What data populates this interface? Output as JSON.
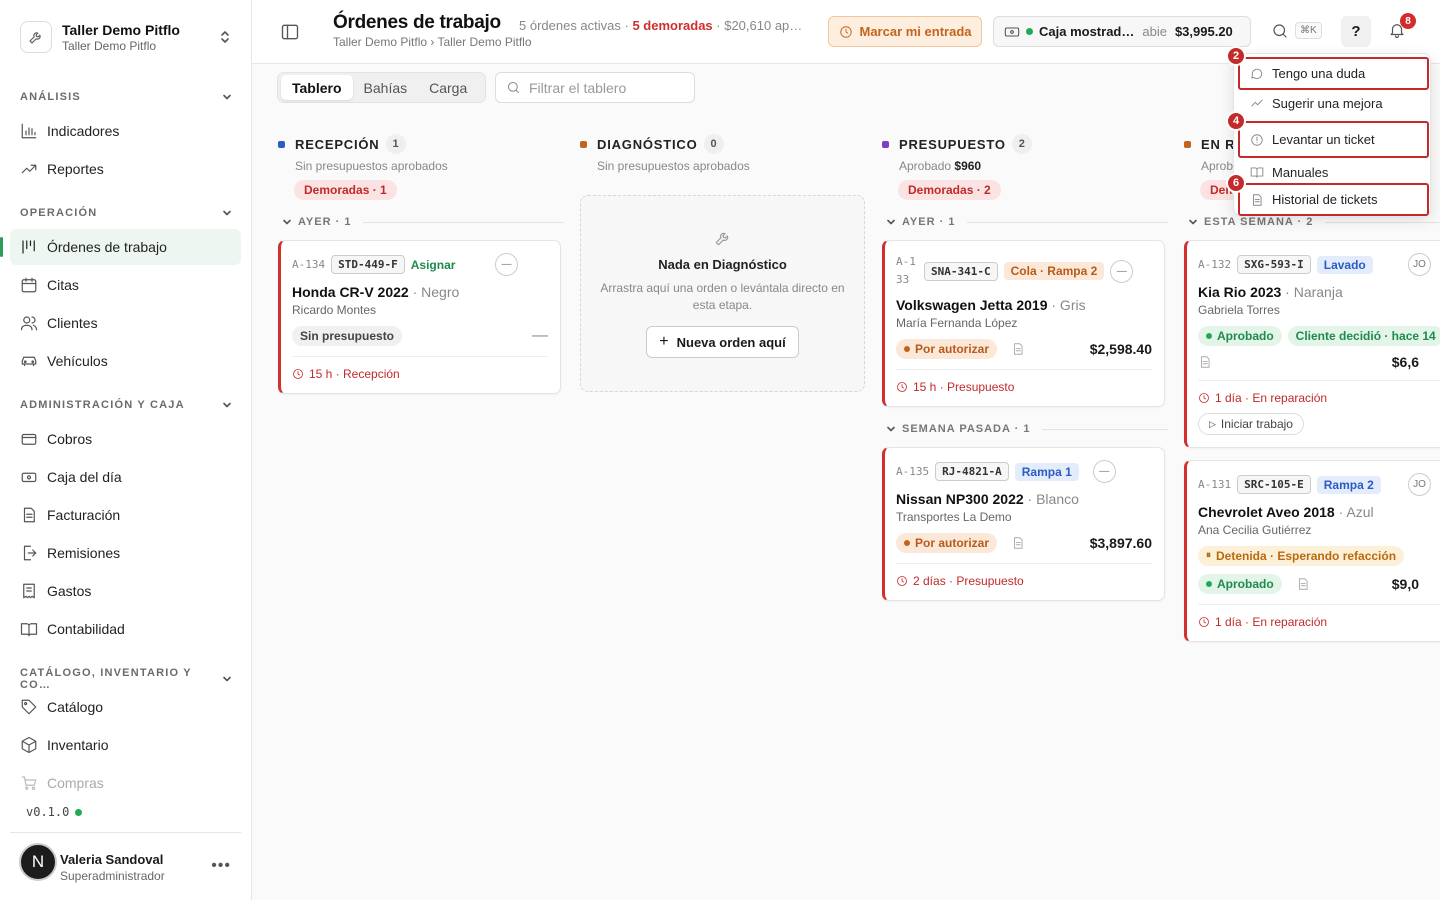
{
  "workspace": {
    "name": "Taller Demo Pitflo",
    "sub": "Taller Demo Pitflo"
  },
  "sidebar": {
    "sections": [
      {
        "label": "ANÁLISIS",
        "items": [
          {
            "label": "Indicadores",
            "icon": "bar-chart-icon"
          },
          {
            "label": "Reportes",
            "icon": "trend-icon"
          }
        ]
      },
      {
        "label": "OPERACIÓN",
        "items": [
          {
            "label": "Órdenes de trabajo",
            "icon": "kanban-icon",
            "active": true
          },
          {
            "label": "Citas",
            "icon": "calendar-icon"
          },
          {
            "label": "Clientes",
            "icon": "users-icon"
          },
          {
            "label": "Vehículos",
            "icon": "car-icon"
          }
        ]
      },
      {
        "label": "ADMINISTRACIÓN Y CAJA",
        "items": [
          {
            "label": "Cobros",
            "icon": "card-icon"
          },
          {
            "label": "Caja del día",
            "icon": "cash-icon"
          },
          {
            "label": "Facturación",
            "icon": "invoice-icon"
          },
          {
            "label": "Remisiones",
            "icon": "export-icon"
          },
          {
            "label": "Gastos",
            "icon": "receipt-icon"
          },
          {
            "label": "Contabilidad",
            "icon": "book-icon"
          }
        ]
      },
      {
        "label": "CATÁLOGO, INVENTARIO Y CO…",
        "items": [
          {
            "label": "Catálogo",
            "icon": "tag-icon"
          },
          {
            "label": "Inventario",
            "icon": "box-icon"
          },
          {
            "label": "Compras",
            "icon": "cart-icon"
          }
        ]
      }
    ],
    "version": "v0.1.0",
    "user": {
      "initial": "N",
      "name": "Valeria Sandoval",
      "role": "Superadministrador"
    }
  },
  "header": {
    "title": "Órdenes de trabajo",
    "summary_a": "5 órdenes activas · ",
    "summary_late": "5 demoradas",
    "summary_b": " · $20,610 ap…",
    "breadcrumb": "Taller Demo Pitflo › Taller Demo Pitflo",
    "entrada_label": "Marcar mi entrada",
    "caja": {
      "name": "Caja mostrad…",
      "status": "abie",
      "amount": "$3,995.20"
    },
    "kbd": "⌘K",
    "help": "?",
    "notif_count": "8"
  },
  "board": {
    "tabs": [
      "Tablero",
      "Bahías",
      "Carga"
    ],
    "filter_placeholder": "Filtrar el tablero",
    "columns": [
      {
        "name": "RECEPCIÓN",
        "count": "1",
        "color": "#2c5bc4",
        "sub": "Sin presupuestos aprobados",
        "late": "Demoradas · 1",
        "groups": [
          {
            "label": "AYER · 1",
            "cards": [
              {
                "id": "A-134",
                "plate": "STD-449-F",
                "tag": "Asignar",
                "model": "Honda CR-V 2022",
                "color": "· Negro",
                "owner": "Ricardo Montes",
                "status": "Sin presupuesto",
                "foot": "15 h · Recepción"
              }
            ]
          }
        ]
      },
      {
        "name": "DIAGNÓSTICO",
        "count": "0",
        "color": "#c4641c",
        "sub": "Sin presupuestos aprobados",
        "empty": {
          "title": "Nada en Diagnóstico",
          "text": "Arrastra aquí una orden o levántala directo en esta etapa.",
          "button": "Nueva orden aquí"
        }
      },
      {
        "name": "PRESUPUESTO",
        "count": "2",
        "color": "#7b3fc4",
        "sub_prefix": "Aprobado ",
        "sub_value": "$960",
        "late": "Demoradas · 2",
        "groups": [
          {
            "label": "AYER · 1",
            "cards": [
              {
                "id": "A-133",
                "plate": "SNA-341-C",
                "tag": "Cola · Rampa 2",
                "model": "Volkswagen Jetta 2019",
                "color": "· Gris",
                "owner": "María Fernanda López",
                "status": "Por autorizar",
                "price": "$2,598.40",
                "foot": "15 h · Presupuesto"
              }
            ]
          },
          {
            "label": "SEMANA PASADA · 1",
            "cards": [
              {
                "id": "A-135",
                "plate": "RJ-4821-A",
                "tag": "Rampa 1",
                "model": "Nissan NP300 2022",
                "color": "· Blanco",
                "owner": "Transportes La Demo",
                "status": "Por autorizar",
                "price": "$3,897.60",
                "foot": "2 días · Presupuesto"
              }
            ]
          }
        ]
      },
      {
        "name": "EN R",
        "count": "",
        "color": "#c4641c",
        "sub": "Aprob",
        "late": "Dem",
        "groups": [
          {
            "label": "ESTA SEMANA · 2",
            "cards": [
              {
                "id": "A-132",
                "plate": "SXG-593-I",
                "tag": "Lavado",
                "initials": "JO",
                "model": "Kia Rio 2023",
                "color": "· Naranja",
                "owner": "Gabriela Torres",
                "status": "Aprobado",
                "extra": "Cliente decidió · hace 14",
                "price": "$6,6",
                "foot": "1 día · En reparación",
                "action": "Iniciar trabajo"
              },
              {
                "id": "A-131",
                "plate": "SRC-105-E",
                "tag": "Rampa 2",
                "initials": "JO",
                "model": "Chevrolet Aveo 2018",
                "color": "· Azul",
                "owner": "Ana Cecilia Gutiérrez",
                "hold": "Detenida · Esperando refacción",
                "status": "Aprobado",
                "price": "$9,0",
                "foot": "1 día · En reparación"
              }
            ]
          }
        ]
      }
    ]
  },
  "help_menu": {
    "items": [
      {
        "label": "Tengo una duda",
        "icon": "chat-icon",
        "marker": "2"
      },
      {
        "label": "Sugerir una mejora",
        "icon": "trend-icon"
      },
      {
        "label": "Levantar un ticket",
        "icon": "alert-circle-icon",
        "marker": "4"
      },
      {
        "label": "Manuales",
        "icon": "book-open-icon"
      },
      {
        "label": "Historial de tickets",
        "icon": "document-icon",
        "marker": "6"
      }
    ]
  },
  "colors": {
    "accent": "#2a9d5c",
    "danger": "#d12d2d",
    "entrada": "#c4641c",
    "marker": "#c32a2a"
  }
}
